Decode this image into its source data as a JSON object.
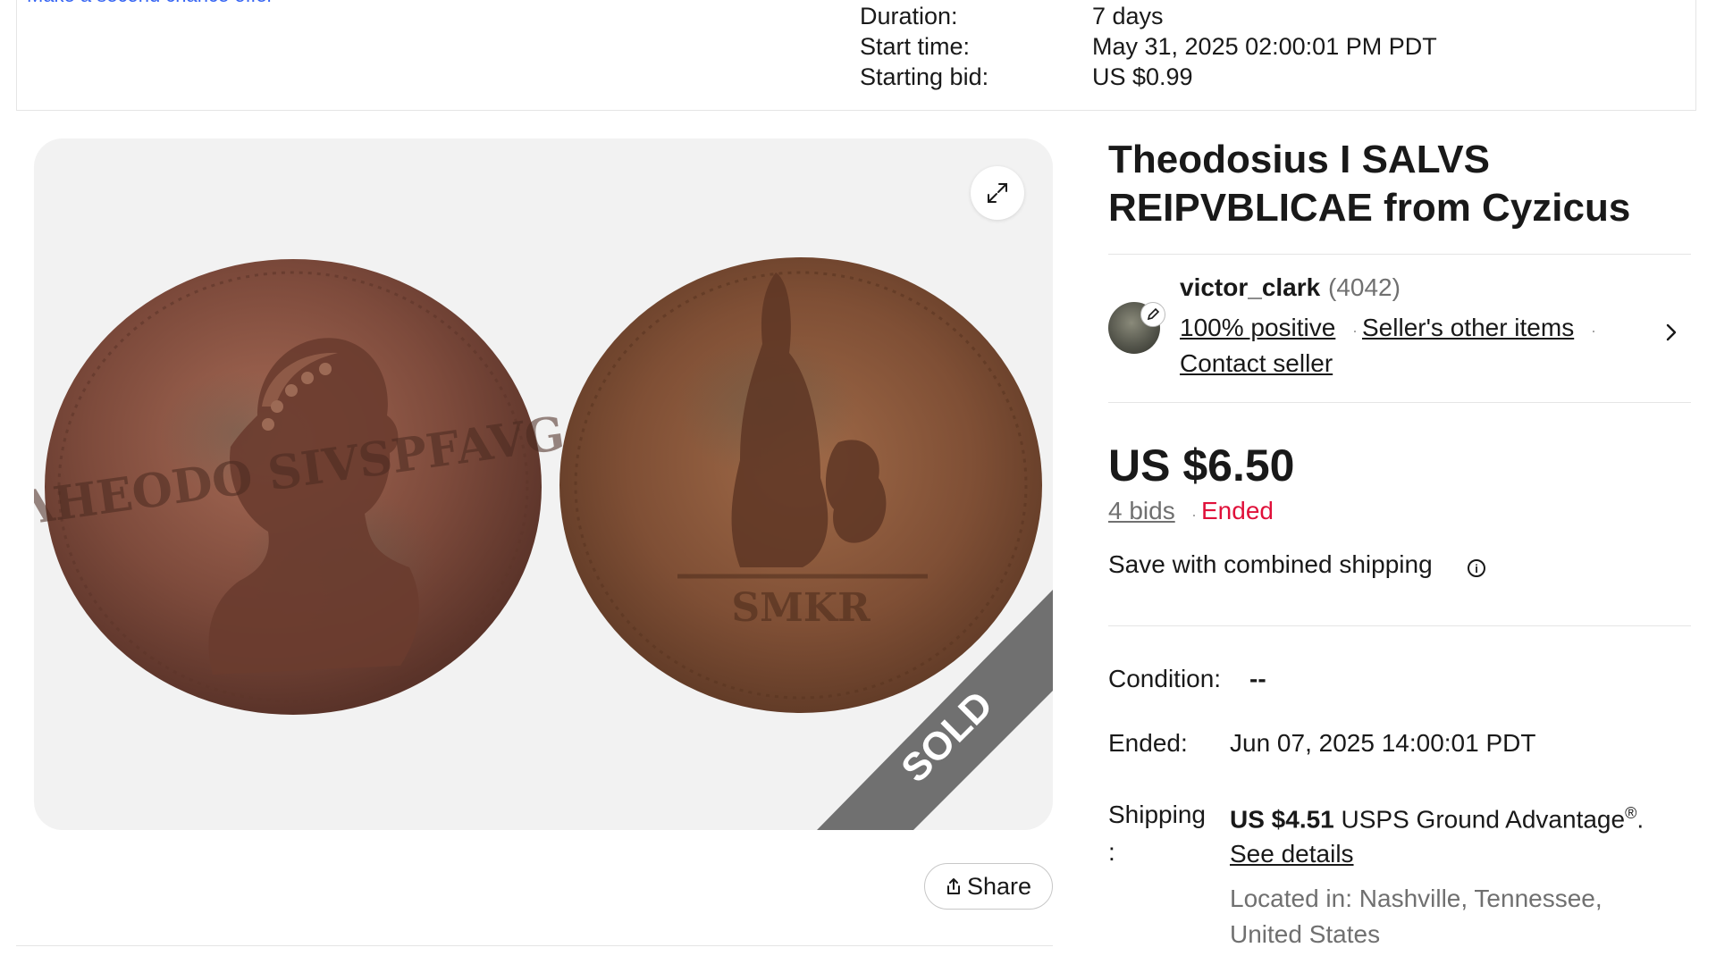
{
  "summary": {
    "cut_link": "Make a second chance offer",
    "rows": [
      {
        "label": "Duration:",
        "value": "7 days"
      },
      {
        "label": "Start time:",
        "value": "May 31, 2025 02:00:01 PM PDT"
      },
      {
        "label": "Starting bid:",
        "value": "US $0.99"
      }
    ]
  },
  "gallery": {
    "sold_banner": "SOLD",
    "share_label": "Share",
    "expand_icon": "expand-icon",
    "coin_obverse_legend": "ΛHEODO SIVSPFAVG",
    "coin_reverse_mint": "SMKR"
  },
  "item": {
    "title_line1": "Theodosius I SALVS",
    "title_line2": "REIPVBLICAE from Cyzicus"
  },
  "seller": {
    "name": "victor_clark",
    "score": "(4042)",
    "positive": "100% positive",
    "other_items": "Seller's other items",
    "contact": "Contact seller"
  },
  "pricing": {
    "price": "US $6.50",
    "bids": "4 bids",
    "status": "Ended",
    "combined_shipping": "Save with combined shipping"
  },
  "details": {
    "condition_label": "Condition:",
    "condition_value": "--",
    "ended_label": "Ended:",
    "ended_value": "Jun 07, 2025 14:00:01 PDT",
    "shipping_label_1": "Shipping",
    "shipping_label_2": ":",
    "shipping_price": "US $4.51",
    "shipping_service": "USPS Ground Advantage",
    "shipping_mark": "®",
    "shipping_period": ".",
    "see_details": "See details",
    "location_line1": "Located in: Nashville, Tennessee,",
    "location_line2": "United States"
  },
  "colors": {
    "link_blue": "#3665f3",
    "ended_red": "#e0103a",
    "text_dark": "#191919",
    "text_gray": "#707070",
    "sold_banner": "#707070"
  }
}
